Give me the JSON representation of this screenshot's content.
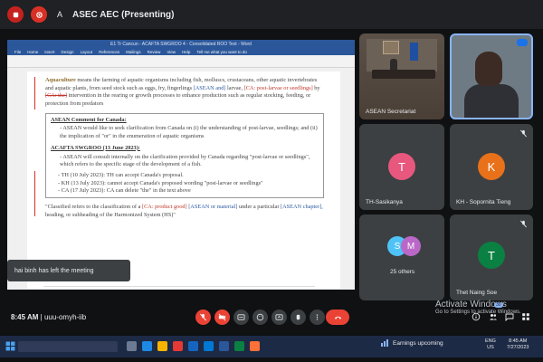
{
  "topbar": {
    "avatar_letter": "A",
    "presenting_label": "ASEC AEC (Presenting)"
  },
  "document": {
    "window_title": "E1 Tr Cancun - ACAFTA SWGROO 4 - Consolidated ROO Text - Word",
    "tabs": [
      "File",
      "Home",
      "Insert",
      "Design",
      "Layout",
      "References",
      "Mailings",
      "Review",
      "View",
      "Help"
    ],
    "tell_me": "Tell me what you want to do",
    "para1": {
      "term": "Aquaculture",
      "text_a": " means the farming of aquatic organisms including fish, molluscs, crustaceans, other aquatic invertebrates and aquatic plants, from seed stock such as eggs, fry, fingerlings ",
      "ins_a": "[ASEAN",
      "ins_a2": " and]",
      "text_b": " larvae, ",
      "ins_b": "[CA: post-larvae or seedlings]",
      "text_c": " by ",
      "del_c": "[CA: the]",
      "text_d": " intervention in the rearing or growth processes to enhance production such as regular stocking, feeding, or protection from predators"
    },
    "box": {
      "heading1": "ASEAN Comment for Canada:",
      "line1": "ASEAN would like to seek clarification from Canada on (i) the understanding of post-larvae, seedlings; and (ii) the implication of \"or\" in the enumeration of aquatic organisms",
      "heading2": "ACAFTA SWGROO (13 June 2023):",
      "line2": "ASEAN will consult internally on the clarification provided by Canada regarding \"post-larvae or seedlings\", which refers to the specific stage of the development of a fish.",
      "item1": "TH (10 July 2023): TH can accept Canada's proposal.",
      "item2": "KH (13 July 2023): cannot accept Canada's proposed wording \"post-larvae or seedlings\"",
      "item3": "CA (17 July 2023): CA can delete \"the\" in the text above"
    },
    "para2": {
      "text_a": "\"Classified refers to the classification of a ",
      "ins_a": "[CA: product good]",
      "sup_a": " [ASEAN",
      "blue_a": " or material]",
      "text_b": " under a particular ",
      "sup_b": "[ASEAN",
      "blue_b": " chapter],",
      "text_c": " heading, or subheading of the Harmonized System (HS)\""
    }
  },
  "toast": "hai binh has left the meeting",
  "participants": [
    {
      "name": "ASEAN Secretariat",
      "type": "video"
    },
    {
      "name": "",
      "type": "video-speaker"
    },
    {
      "name": "TH-Sasikanya",
      "letter": "T",
      "color": "#e8577e",
      "muted": true
    },
    {
      "name": "KH - Sopornita Tieng",
      "letter": "K",
      "color": "#e8711a",
      "muted": true
    },
    {
      "name": "25 others",
      "letters": [
        "S",
        "M"
      ],
      "colors": [
        "#4fc3f7",
        "#ba68c8"
      ]
    },
    {
      "name": "Thet Naing Soe",
      "letter": "T",
      "color": "#0b8043",
      "muted": true
    }
  ],
  "meeting": {
    "time": "8:45 AM",
    "separator": "|",
    "code": "uuu-omyh-iib",
    "people_count": "30"
  },
  "activate": {
    "title": "Activate Windows",
    "subtitle": "Go to Settings to activate Windows."
  },
  "taskbar": {
    "news": "Earnings upcoming",
    "lang": "ENG",
    "region": "US",
    "time": "8:45 AM",
    "date": "7/27/2023"
  },
  "colors": {
    "accent": "#8ab4f8",
    "leave": "#ea4335",
    "word_blue": "#2b579a"
  }
}
